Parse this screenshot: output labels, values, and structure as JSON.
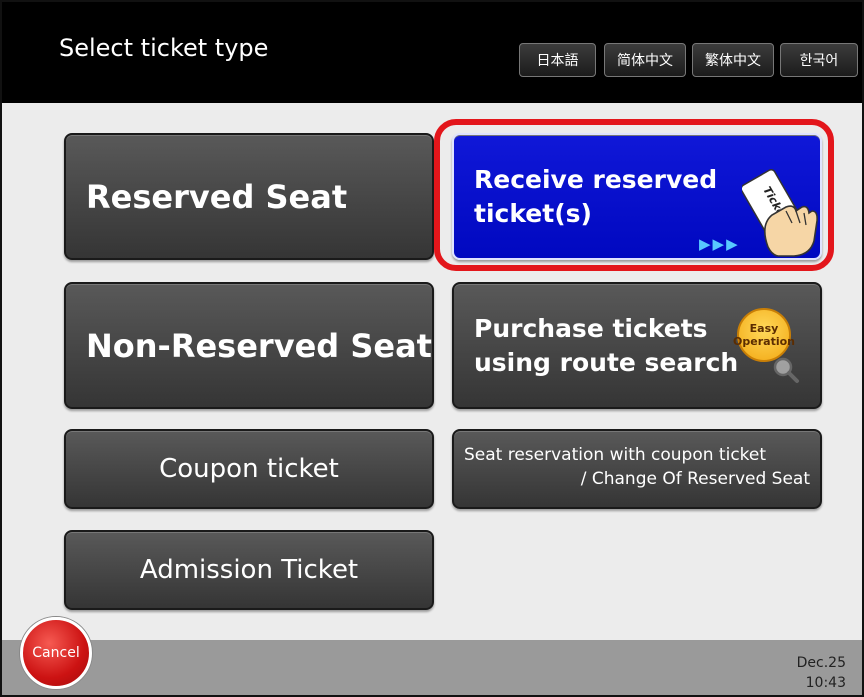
{
  "header": {
    "title": "Select ticket type",
    "languages": [
      "日本語",
      "简体中文",
      "繁体中文",
      "한국어"
    ]
  },
  "buttons": {
    "reserved_seat": "Reserved Seat",
    "non_reserved_seat": "Non-Reserved Seat",
    "coupon_ticket": "Coupon ticket",
    "admission_ticket": "Admission Ticket",
    "receive_reserved": {
      "line1": "Receive reserved",
      "line2": "ticket(s)",
      "arrows": "▶▶▶"
    },
    "purchase_route": {
      "line1": "Purchase tickets",
      "line2": "using route search",
      "badge1": "Easy",
      "badge2": "Operation"
    },
    "seat_reservation_coupon": {
      "line1": "Seat reservation with coupon ticket",
      "line2": "/ Change Of Reserved Seat"
    },
    "ticket_card_text": "Ticket"
  },
  "footer": {
    "cancel": "Cancel",
    "date": "Dec.25",
    "time": "10:43"
  },
  "colors": {
    "highlight": "#e3161b",
    "receive_button": "#0a12d0",
    "cancel": "#cc1212"
  }
}
